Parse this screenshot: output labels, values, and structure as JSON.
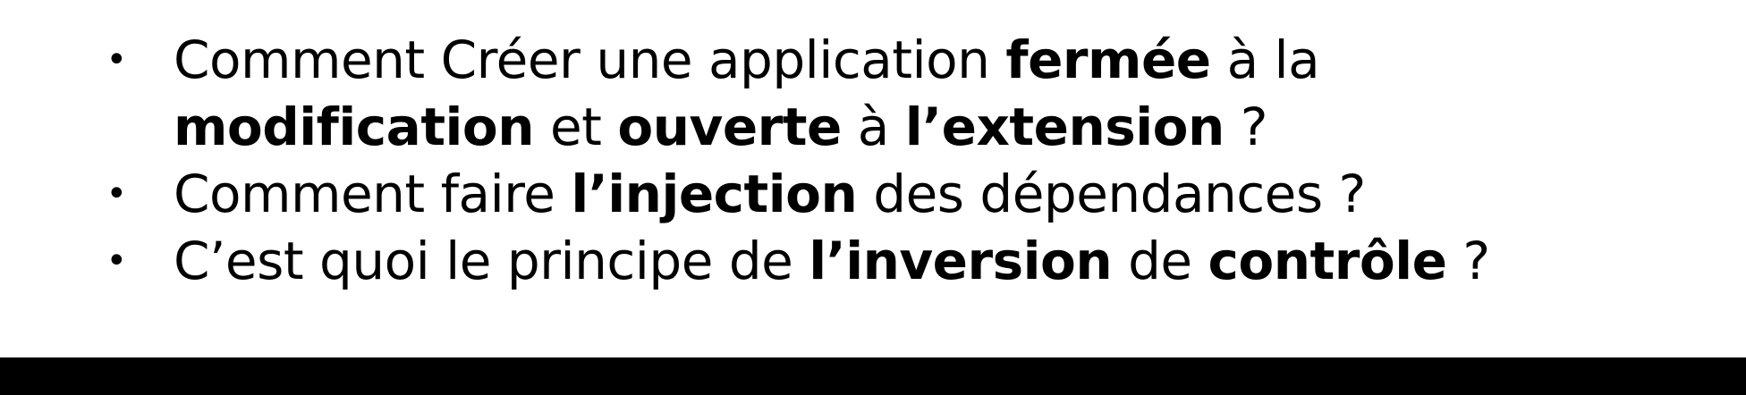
{
  "slide": {
    "bullets": [
      {
        "marker": "•",
        "segments": [
          {
            "text": "Comment Créer une application ",
            "bold": false
          },
          {
            "text": "fermée",
            "bold": true
          },
          {
            "text": " à la ",
            "bold": false
          },
          {
            "text": "modification",
            "bold": true
          },
          {
            "text": " et ",
            "bold": false
          },
          {
            "text": "ouverte",
            "bold": true
          },
          {
            "text": " à ",
            "bold": false
          },
          {
            "text": "l’extension",
            "bold": true
          },
          {
            "text": " ?",
            "bold": false
          }
        ]
      },
      {
        "marker": "•",
        "segments": [
          {
            "text": "Comment faire ",
            "bold": false
          },
          {
            "text": "l’injection",
            "bold": true
          },
          {
            "text": " des dépendances ?",
            "bold": false
          }
        ]
      },
      {
        "marker": "•",
        "segments": [
          {
            "text": "C’est quoi le principe de ",
            "bold": false
          },
          {
            "text": "l’inversion",
            "bold": true
          },
          {
            "text": " de ",
            "bold": false
          },
          {
            "text": "contrôle",
            "bold": true
          },
          {
            "text": " ?",
            "bold": false
          }
        ]
      }
    ]
  },
  "colors": {
    "background": "#ffffff",
    "text": "#000000",
    "bottom_bar": "#000000"
  }
}
